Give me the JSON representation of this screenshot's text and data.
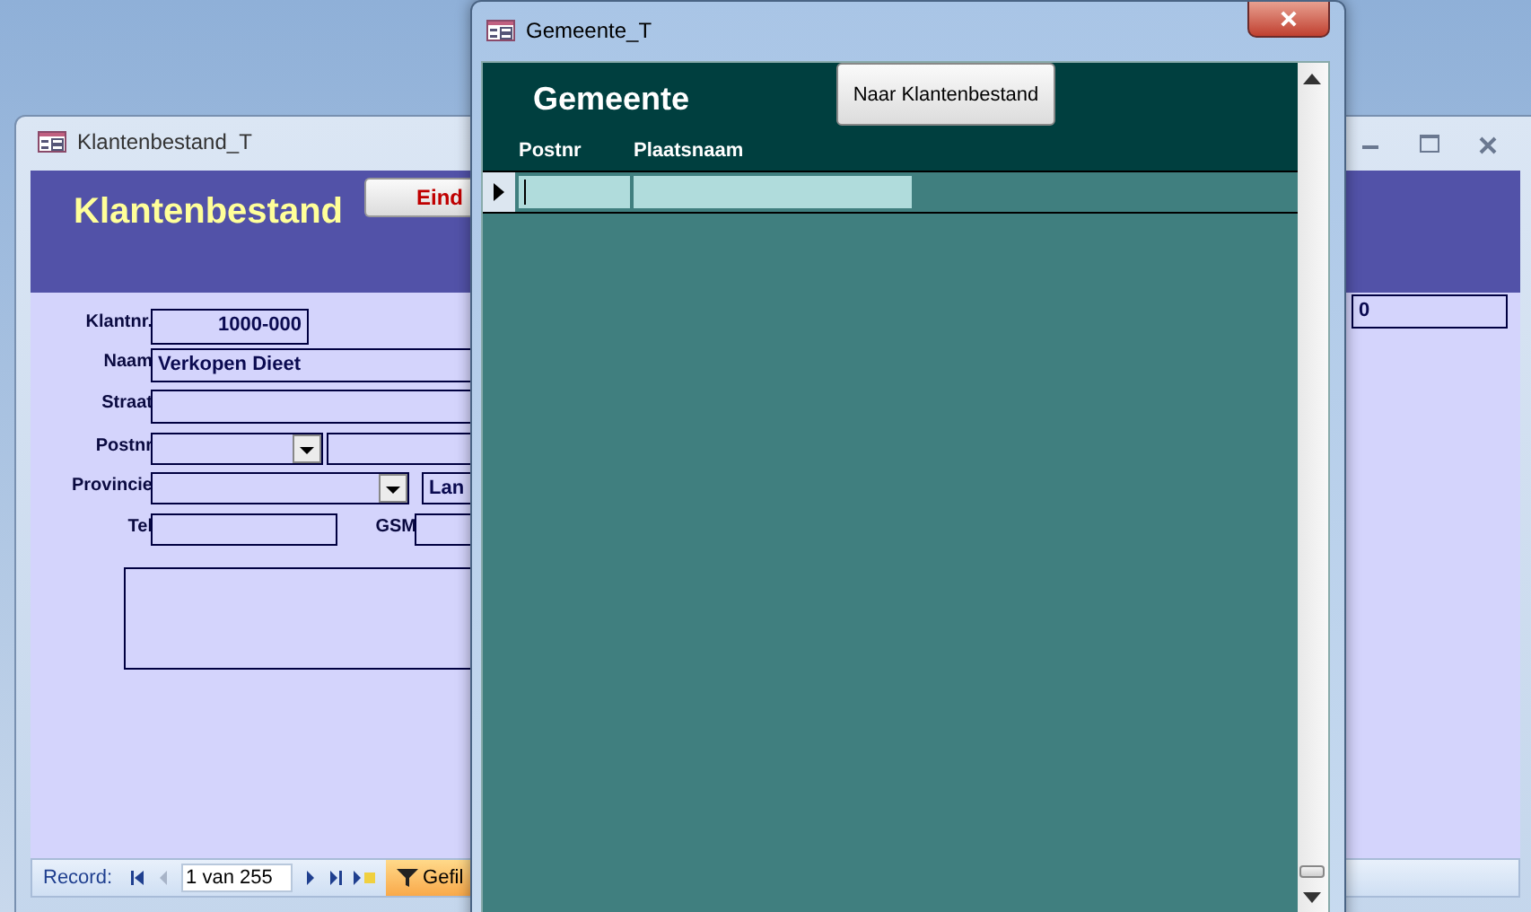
{
  "back_window": {
    "title": "Klantenbestand_T",
    "heading": "Klantenbestand",
    "close_form_button": "Eind",
    "fields": [
      {
        "label": "Klantnr.",
        "value": "1000-000",
        "kind": "text"
      },
      {
        "label": "Naam",
        "value": "Verkopen Dieet",
        "kind": "text"
      },
      {
        "label": "Straat",
        "kind": "text"
      },
      {
        "label": "Postnr",
        "kind": "combo"
      },
      {
        "kind": "text"
      },
      {
        "label": "Provincie",
        "kind": "combo"
      },
      {
        "value": "Lan",
        "kind": "text"
      },
      {
        "label": "Tel",
        "kind": "text"
      },
      {
        "label": "GSM",
        "kind": "text"
      },
      {
        "kind": "memo"
      },
      {
        "value": "0",
        "kind": "text"
      }
    ],
    "navigation": {
      "label": "Record:",
      "position": "1 van 255",
      "filter_button": "Gefil"
    }
  },
  "front_window": {
    "title": "Gemeente_T",
    "heading": "Gemeente",
    "button": "Naar Klantenbestand",
    "columns": [
      "Postnr",
      "Plaatsnaam"
    ],
    "rows": [
      {
        "current": true
      }
    ]
  }
}
